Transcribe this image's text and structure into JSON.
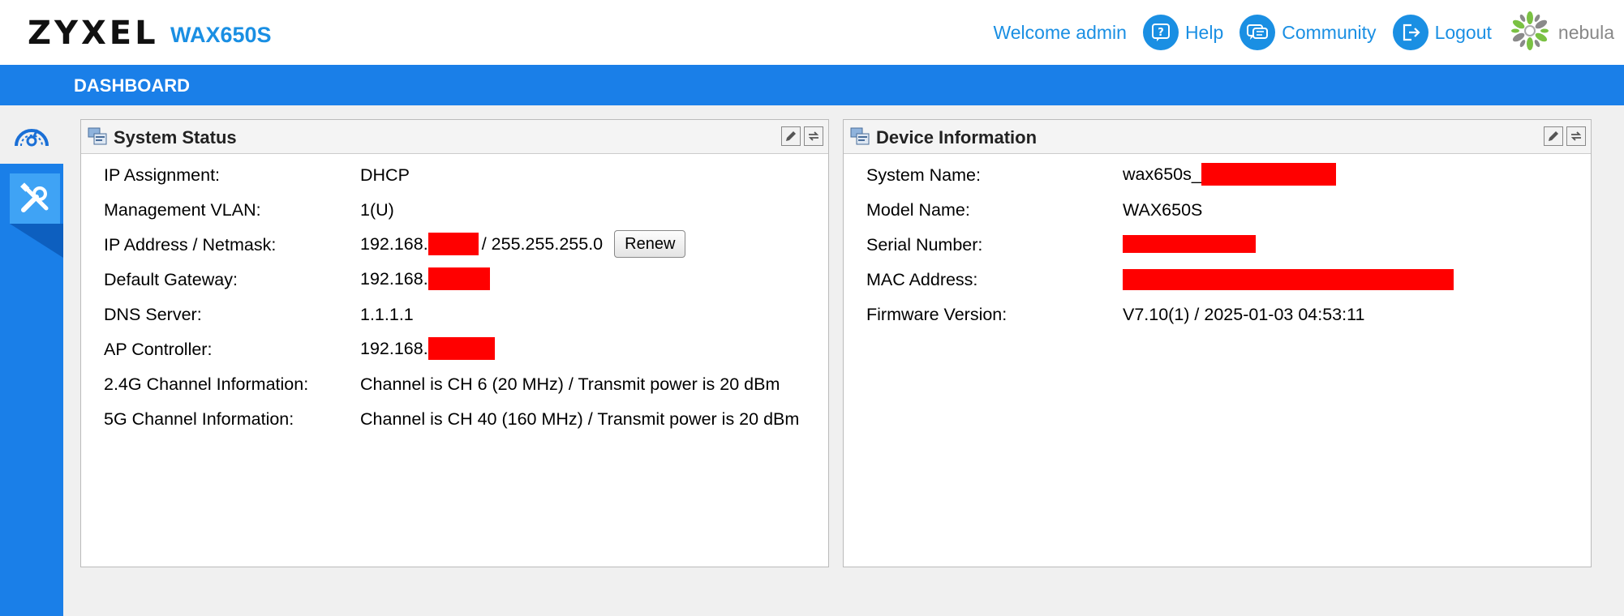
{
  "header": {
    "logo": "ZYXEL",
    "model": "WAX650S",
    "welcome": "Welcome admin",
    "help_label": "Help",
    "community_label": "Community",
    "logout_label": "Logout",
    "nebula_label": "nebula"
  },
  "bluebar": {
    "title": "DASHBOARD"
  },
  "colors": {
    "brand_blue": "#1a7fe8",
    "link_blue": "#1a8fe3",
    "redaction": "#ff0000"
  },
  "system_status": {
    "title": "System Status",
    "rows": [
      {
        "label": "IP Assignment:",
        "value": "DHCP"
      },
      {
        "label": "Management VLAN:",
        "value": "1(U)"
      },
      {
        "label": "IP Address / Netmask:",
        "value_prefix": "192.168.",
        "value_suffix": "/ 255.255.255.0",
        "button": "Renew"
      },
      {
        "label": "Default Gateway:",
        "value_prefix": "192.168."
      },
      {
        "label": "DNS Server:",
        "value": "1.1.1.1"
      },
      {
        "label": "AP Controller:",
        "value_prefix": "192.168."
      },
      {
        "label": "2.4G Channel Information:",
        "value": "Channel is CH 6 (20 MHz) / Transmit power is 20 dBm"
      },
      {
        "label": "5G Channel Information:",
        "value": "Channel is CH 40 (160 MHz) / Transmit power is 20 dBm"
      }
    ]
  },
  "device_info": {
    "title": "Device Information",
    "rows": [
      {
        "label": "System Name:",
        "value_prefix": "wax650s_"
      },
      {
        "label": "Model Name:",
        "value": "WAX650S"
      },
      {
        "label": "Serial Number:"
      },
      {
        "label": "MAC Address:"
      },
      {
        "label": "Firmware Version:",
        "value": "V7.10(1) / 2025-01-03 04:53:11"
      }
    ]
  }
}
